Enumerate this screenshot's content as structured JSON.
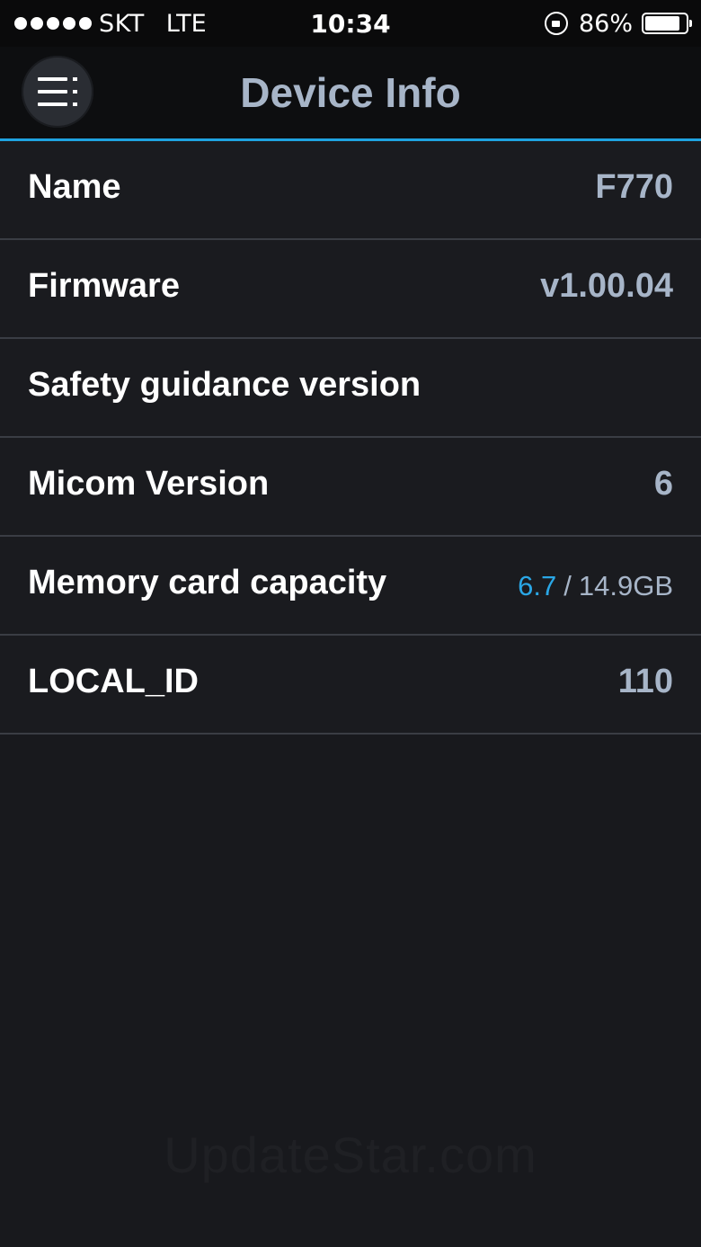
{
  "status_bar": {
    "carrier": "SKT",
    "network": "LTE",
    "time": "10:34",
    "battery_percent": "86%"
  },
  "header": {
    "title": "Device Info",
    "menu_icon": "menu-icon"
  },
  "rows": [
    {
      "label": "Name",
      "value": "F770"
    },
    {
      "label": "Firmware",
      "value": "v1.00.04"
    },
    {
      "label": "Safety guidance version",
      "value": ""
    },
    {
      "label": "Micom Version",
      "value": "6"
    },
    {
      "label": "Memory card capacity",
      "used": "6.7",
      "separator": "/",
      "total": "14.9GB"
    },
    {
      "label": "LOCAL_ID",
      "value": "110"
    }
  ],
  "watermark": "UpdateStar.com",
  "colors": {
    "accent": "#1fa3e0",
    "title": "#a7b5c8",
    "capacity_used": "#2aa7e6",
    "background": "#18191d"
  }
}
